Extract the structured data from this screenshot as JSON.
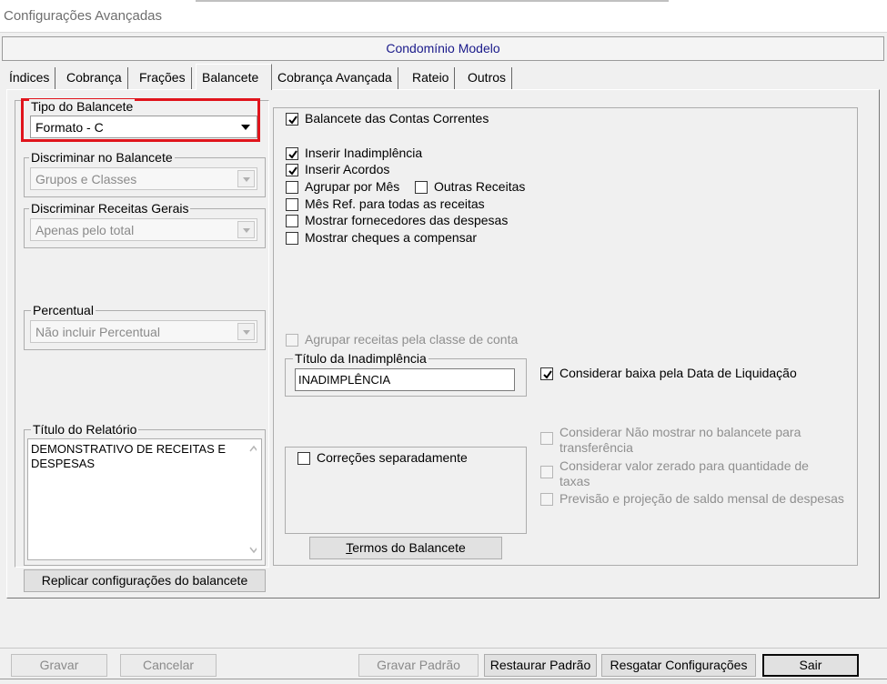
{
  "window": {
    "title": "Configurações Avançadas"
  },
  "header": {
    "condominium": "Condomínio Modelo"
  },
  "tabs": [
    {
      "label": "Índices"
    },
    {
      "label": "Cobrança"
    },
    {
      "label": "Frações"
    },
    {
      "label": "Balancete",
      "active": true
    },
    {
      "label": "Cobrança Avançada"
    },
    {
      "label": "Rateio"
    },
    {
      "label": "Outros"
    }
  ],
  "left": {
    "tipo": {
      "label": "Tipo do Balancete",
      "value": "Formato - C"
    },
    "discriminar": {
      "label": "Discriminar no Balancete",
      "value": "Grupos e Classes"
    },
    "receitas": {
      "label": "Discriminar Receitas Gerais",
      "value": "Apenas pelo total"
    },
    "percentual": {
      "label": "Percentual",
      "value": "Não incluir Percentual"
    },
    "titulo_relatorio": {
      "label": "Título do Relatório",
      "value": "DEMONSTRATIVO DE RECEITAS E DESPESAS"
    },
    "replicar_button": "Replicar configurações do balancete"
  },
  "right": {
    "contas_correntes": {
      "label": "Balancete das Contas Correntes",
      "checked": true
    },
    "inserir_inadimplencia": {
      "label": "Inserir Inadimplência",
      "checked": true
    },
    "inserir_acordos": {
      "label": "Inserir Acordos",
      "checked": true
    },
    "agrupar_mes": {
      "label": "Agrupar por Mês",
      "checked": false
    },
    "outras_receitas": {
      "label": "Outras Receitas",
      "checked": false
    },
    "mes_ref": {
      "label": "Mês Ref. para todas as receitas",
      "checked": false
    },
    "mostrar_fornecedores": {
      "label": "Mostrar fornecedores das despesas",
      "checked": false
    },
    "mostrar_cheques": {
      "label": "Mostrar cheques a compensar",
      "checked": false
    },
    "agrupar_receitas": {
      "label": "Agrupar receitas pela classe de conta",
      "checked": false,
      "disabled": true
    },
    "titulo_inadimplencia": {
      "label": "Título da Inadimplência",
      "value": "INADIMPLÊNCIA"
    },
    "considerar_baixa": {
      "label": "Considerar baixa pela Data de Liquidação",
      "checked": true
    },
    "correcoes": {
      "label": "Correções separadamente",
      "checked": false
    },
    "termos_button": "Termos do Balancete",
    "nao_mostrar": {
      "line1": "Considerar Não mostrar no balancete para",
      "line2": "transferência",
      "checked": false,
      "disabled": true
    },
    "valor_zerado": {
      "line1": "Considerar valor zerado para quantidade de",
      "line2": "taxas",
      "checked": false,
      "disabled": true
    },
    "previsao": {
      "label": "Previsão e projeção de saldo mensal de despesas",
      "checked": false,
      "disabled": true
    }
  },
  "footer": {
    "gravar": "Gravar",
    "cancelar": "Cancelar",
    "gravar_padrao": "Gravar Padrão",
    "restaurar_padrao": "Restaurar Padrão",
    "resgatar": "Resgatar Configurações",
    "sair": "Sair"
  },
  "colors": {
    "highlight": "#e0141c",
    "header_text": "#1a1a8a"
  }
}
